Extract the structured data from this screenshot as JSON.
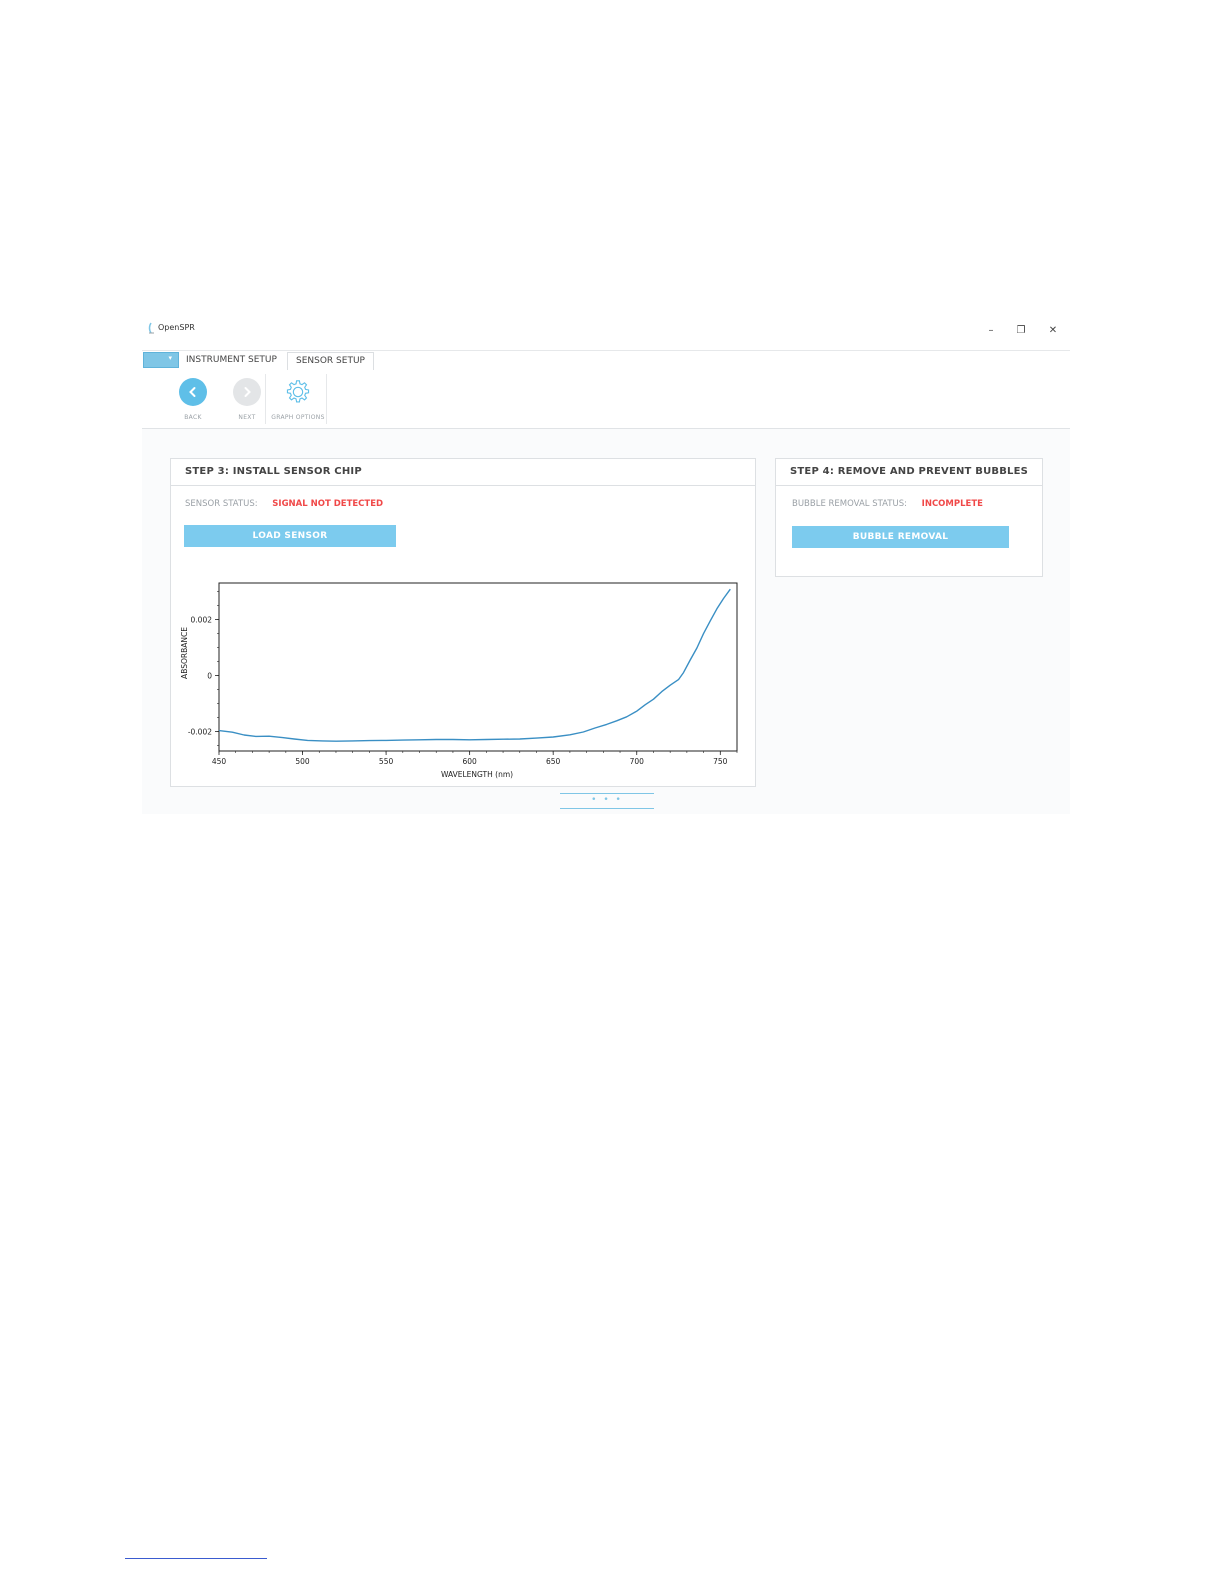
{
  "window": {
    "title": "OpenSPR",
    "controls": {
      "minimize": "–",
      "restore": "❐",
      "close": "✕"
    }
  },
  "tabs": {
    "menu_arrow": "▾",
    "items": [
      {
        "label": "INSTRUMENT SETUP",
        "active": false
      },
      {
        "label": "SENSOR SETUP",
        "active": true
      }
    ]
  },
  "toolbar": {
    "back_label": "BACK",
    "next_label": "NEXT",
    "graph_options_label": "GRAPH OPTIONS",
    "back_icon": "chevron-left-icon",
    "next_icon": "chevron-right-icon",
    "graph_options_icon": "gear-icon"
  },
  "step3": {
    "title": "STEP 3: INSTALL SENSOR CHIP",
    "status_label": "SENSOR STATUS:",
    "status_value": "SIGNAL NOT DETECTED",
    "button_label": "LOAD SENSOR"
  },
  "step4": {
    "title": "STEP 4: REMOVE AND PREVENT BUBBLES",
    "status_label": "BUBBLE REMOVAL STATUS:",
    "status_value": "INCOMPLETE",
    "button_label": "BUBBLE REMOVAL"
  },
  "pager": {
    "label": "• • •"
  },
  "colors": {
    "accent": "#7ccbee",
    "status_red": "#f04848",
    "line": "#3a8fc4"
  },
  "chart_data": {
    "type": "line",
    "xlabel": "WAVELENGTH (nm)",
    "ylabel": "ABSORBANCE",
    "xlim": [
      450,
      760
    ],
    "ylim": [
      -0.0027,
      0.0033
    ],
    "xticks": [
      450,
      500,
      550,
      600,
      650,
      700,
      750
    ],
    "yticks": [
      -0.002,
      0,
      0.002
    ],
    "ytick_labels": [
      "-0.002",
      "0",
      "0.002"
    ],
    "grid": false,
    "x": [
      450,
      458,
      465,
      472,
      480,
      488,
      495,
      503,
      512,
      520,
      530,
      540,
      550,
      560,
      570,
      580,
      590,
      600,
      610,
      620,
      630,
      640,
      650,
      660,
      668,
      675,
      682,
      688,
      694,
      700,
      705,
      710,
      715,
      720,
      725,
      728,
      732,
      736,
      740,
      744,
      748,
      752,
      756
    ],
    "y": [
      -0.00197,
      -0.00203,
      -0.00213,
      -0.00218,
      -0.00217,
      -0.00222,
      -0.00227,
      -0.00232,
      -0.00234,
      -0.00235,
      -0.00234,
      -0.00233,
      -0.00232,
      -0.00231,
      -0.0023,
      -0.00229,
      -0.00229,
      -0.0023,
      -0.00229,
      -0.00228,
      -0.00227,
      -0.00224,
      -0.0022,
      -0.00212,
      -0.00202,
      -0.00188,
      -0.00175,
      -0.00162,
      -0.00148,
      -0.00128,
      -0.00105,
      -0.00085,
      -0.00058,
      -0.00035,
      -0.00015,
      0.0001,
      0.00055,
      0.00098,
      0.0015,
      0.00195,
      0.00238,
      0.00275,
      0.00308
    ]
  }
}
